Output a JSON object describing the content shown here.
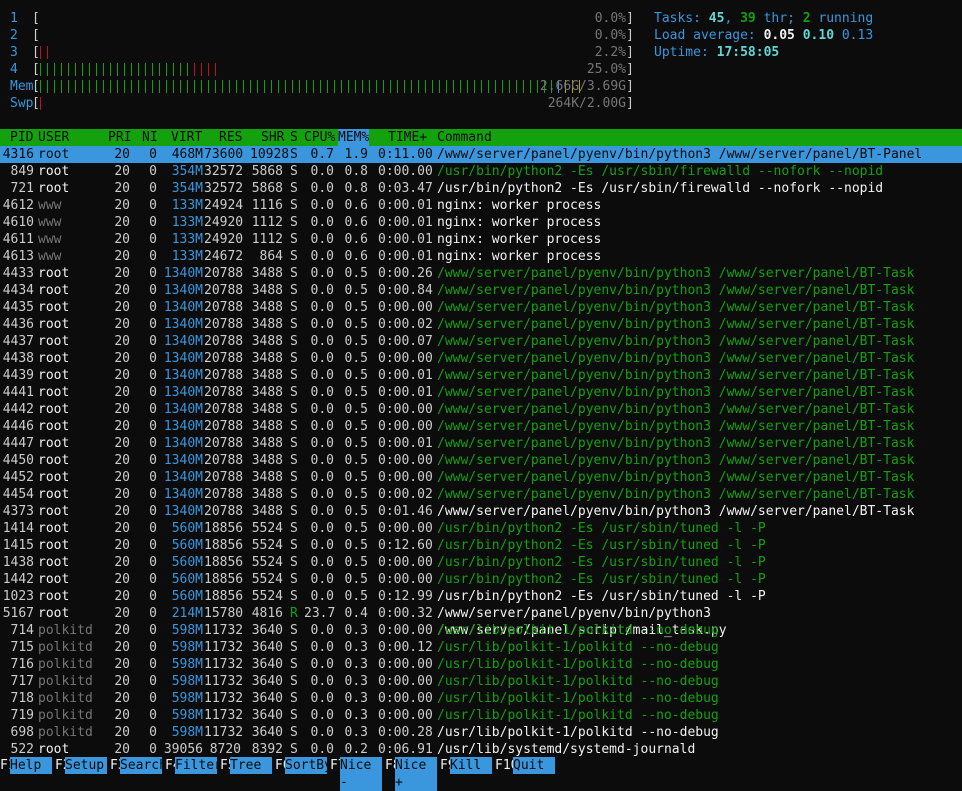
{
  "meters": [
    {
      "label": "1",
      "percent": "0.0%",
      "bars": []
    },
    {
      "label": "2",
      "percent": "0.0%",
      "bars": []
    },
    {
      "label": "3",
      "percent": "2.2%",
      "bars": [
        "r",
        "r"
      ]
    },
    {
      "label": "4",
      "percent": "25.0%",
      "bars": [
        "g",
        "g",
        "g",
        "g",
        "g",
        "g",
        "g",
        "g",
        "g",
        "g",
        "g",
        "g",
        "g",
        "g",
        "g",
        "g",
        "g",
        "g",
        "g",
        "g",
        "g",
        "g",
        "r",
        "r",
        "r",
        "r"
      ]
    },
    {
      "label": "Mem",
      "percent": "2.66G/3.69G",
      "bars": [
        "g",
        "g",
        "g",
        "g",
        "g",
        "g",
        "g",
        "g",
        "g",
        "g",
        "g",
        "g",
        "g",
        "g",
        "g",
        "g",
        "g",
        "g",
        "g",
        "g",
        "g",
        "g",
        "g",
        "g",
        "g",
        "g",
        "g",
        "g",
        "g",
        "g",
        "g",
        "g",
        "g",
        "g",
        "g",
        "g",
        "g",
        "g",
        "g",
        "g",
        "g",
        "g",
        "g",
        "g",
        "g",
        "g",
        "g",
        "g",
        "g",
        "g",
        "g",
        "g",
        "g",
        "g",
        "g",
        "g",
        "g",
        "g",
        "g",
        "g",
        "g",
        "g",
        "g",
        "g",
        "g",
        "g",
        "g",
        "g",
        "g",
        "g",
        "g",
        "g",
        "g",
        "g",
        "b",
        "y",
        "y",
        "y"
      ]
    },
    {
      "label": "Swp",
      "percent": "264K/2.00G",
      "bars": [
        "r"
      ]
    }
  ],
  "summary": {
    "tasks_label": "Tasks: ",
    "tasks": "45",
    "sep1": ", ",
    "threads": "39",
    "thr_label": " thr; ",
    "running": "2",
    "running_label": " running",
    "load_label": "Load average: ",
    "load1": "0.05",
    "load5": "0.10",
    "load15": "0.13",
    "uptime_label": "Uptime: ",
    "uptime": "17:58:05"
  },
  "columns": {
    "pid": "PID",
    "user": "USER",
    "pri": "PRI",
    "ni": "NI",
    "virt": "VIRT",
    "res": "RES",
    "shr": "SHR",
    "s": "S",
    "cpu": "CPU%",
    "mem": "MEM%",
    "time": "TIME+",
    "cmd": "Command"
  },
  "processes": [
    {
      "pid": "4316",
      "user": "root",
      "pri": "20",
      "ni": "0",
      "virt": "468M",
      "res": "73600",
      "shr": "10928",
      "s": "S",
      "cpu": "0.7",
      "mem": "1.9",
      "time": "0:11.00",
      "cmd": "/www/server/panel/pyenv/bin/python3 /www/server/panel/BT-Panel",
      "selected": true
    },
    {
      "pid": "849",
      "user": "root",
      "pri": "20",
      "ni": "0",
      "virt": "354M",
      "res": "32572",
      "shr": "5868",
      "s": "S",
      "cpu": "0.0",
      "mem": "0.8",
      "time": "0:00.00",
      "cmd": "/usr/bin/python2 -Es /usr/sbin/firewalld --nofork --nopid",
      "thread": true
    },
    {
      "pid": "721",
      "user": "root",
      "pri": "20",
      "ni": "0",
      "virt": "354M",
      "res": "32572",
      "shr": "5868",
      "s": "S",
      "cpu": "0.0",
      "mem": "0.8",
      "time": "0:03.47",
      "cmd": "/usr/bin/python2 -Es /usr/sbin/firewalld --nofork --nopid"
    },
    {
      "pid": "4612",
      "user": "www",
      "pri": "20",
      "ni": "0",
      "virt": "133M",
      "res": "24924",
      "shr": "1116",
      "s": "S",
      "cpu": "0.0",
      "mem": "0.6",
      "time": "0:00.01",
      "cmd": "nginx: worker process"
    },
    {
      "pid": "4610",
      "user": "www",
      "pri": "20",
      "ni": "0",
      "virt": "133M",
      "res": "24920",
      "shr": "1112",
      "s": "S",
      "cpu": "0.0",
      "mem": "0.6",
      "time": "0:00.01",
      "cmd": "nginx: worker process"
    },
    {
      "pid": "4611",
      "user": "www",
      "pri": "20",
      "ni": "0",
      "virt": "133M",
      "res": "24920",
      "shr": "1112",
      "s": "S",
      "cpu": "0.0",
      "mem": "0.6",
      "time": "0:00.01",
      "cmd": "nginx: worker process"
    },
    {
      "pid": "4613",
      "user": "www",
      "pri": "20",
      "ni": "0",
      "virt": "133M",
      "res": "24672",
      "shr": "864",
      "s": "S",
      "cpu": "0.0",
      "mem": "0.6",
      "time": "0:00.01",
      "cmd": "nginx: worker process"
    },
    {
      "pid": "4433",
      "user": "root",
      "pri": "20",
      "ni": "0",
      "virt": "1340M",
      "res": "20788",
      "shr": "3488",
      "s": "S",
      "cpu": "0.0",
      "mem": "0.5",
      "time": "0:00.26",
      "cmd": "/www/server/panel/pyenv/bin/python3 /www/server/panel/BT-Task",
      "thread": true
    },
    {
      "pid": "4434",
      "user": "root",
      "pri": "20",
      "ni": "0",
      "virt": "1340M",
      "res": "20788",
      "shr": "3488",
      "s": "S",
      "cpu": "0.0",
      "mem": "0.5",
      "time": "0:00.84",
      "cmd": "/www/server/panel/pyenv/bin/python3 /www/server/panel/BT-Task",
      "thread": true
    },
    {
      "pid": "4435",
      "user": "root",
      "pri": "20",
      "ni": "0",
      "virt": "1340M",
      "res": "20788",
      "shr": "3488",
      "s": "S",
      "cpu": "0.0",
      "mem": "0.5",
      "time": "0:00.00",
      "cmd": "/www/server/panel/pyenv/bin/python3 /www/server/panel/BT-Task",
      "thread": true
    },
    {
      "pid": "4436",
      "user": "root",
      "pri": "20",
      "ni": "0",
      "virt": "1340M",
      "res": "20788",
      "shr": "3488",
      "s": "S",
      "cpu": "0.0",
      "mem": "0.5",
      "time": "0:00.02",
      "cmd": "/www/server/panel/pyenv/bin/python3 /www/server/panel/BT-Task",
      "thread": true
    },
    {
      "pid": "4437",
      "user": "root",
      "pri": "20",
      "ni": "0",
      "virt": "1340M",
      "res": "20788",
      "shr": "3488",
      "s": "S",
      "cpu": "0.0",
      "mem": "0.5",
      "time": "0:00.07",
      "cmd": "/www/server/panel/pyenv/bin/python3 /www/server/panel/BT-Task",
      "thread": true
    },
    {
      "pid": "4438",
      "user": "root",
      "pri": "20",
      "ni": "0",
      "virt": "1340M",
      "res": "20788",
      "shr": "3488",
      "s": "S",
      "cpu": "0.0",
      "mem": "0.5",
      "time": "0:00.00",
      "cmd": "/www/server/panel/pyenv/bin/python3 /www/server/panel/BT-Task",
      "thread": true
    },
    {
      "pid": "4439",
      "user": "root",
      "pri": "20",
      "ni": "0",
      "virt": "1340M",
      "res": "20788",
      "shr": "3488",
      "s": "S",
      "cpu": "0.0",
      "mem": "0.5",
      "time": "0:00.01",
      "cmd": "/www/server/panel/pyenv/bin/python3 /www/server/panel/BT-Task",
      "thread": true
    },
    {
      "pid": "4441",
      "user": "root",
      "pri": "20",
      "ni": "0",
      "virt": "1340M",
      "res": "20788",
      "shr": "3488",
      "s": "S",
      "cpu": "0.0",
      "mem": "0.5",
      "time": "0:00.01",
      "cmd": "/www/server/panel/pyenv/bin/python3 /www/server/panel/BT-Task",
      "thread": true
    },
    {
      "pid": "4442",
      "user": "root",
      "pri": "20",
      "ni": "0",
      "virt": "1340M",
      "res": "20788",
      "shr": "3488",
      "s": "S",
      "cpu": "0.0",
      "mem": "0.5",
      "time": "0:00.00",
      "cmd": "/www/server/panel/pyenv/bin/python3 /www/server/panel/BT-Task",
      "thread": true
    },
    {
      "pid": "4446",
      "user": "root",
      "pri": "20",
      "ni": "0",
      "virt": "1340M",
      "res": "20788",
      "shr": "3488",
      "s": "S",
      "cpu": "0.0",
      "mem": "0.5",
      "time": "0:00.00",
      "cmd": "/www/server/panel/pyenv/bin/python3 /www/server/panel/BT-Task",
      "thread": true
    },
    {
      "pid": "4447",
      "user": "root",
      "pri": "20",
      "ni": "0",
      "virt": "1340M",
      "res": "20788",
      "shr": "3488",
      "s": "S",
      "cpu": "0.0",
      "mem": "0.5",
      "time": "0:00.01",
      "cmd": "/www/server/panel/pyenv/bin/python3 /www/server/panel/BT-Task",
      "thread": true
    },
    {
      "pid": "4450",
      "user": "root",
      "pri": "20",
      "ni": "0",
      "virt": "1340M",
      "res": "20788",
      "shr": "3488",
      "s": "S",
      "cpu": "0.0",
      "mem": "0.5",
      "time": "0:00.00",
      "cmd": "/www/server/panel/pyenv/bin/python3 /www/server/panel/BT-Task",
      "thread": true
    },
    {
      "pid": "4452",
      "user": "root",
      "pri": "20",
      "ni": "0",
      "virt": "1340M",
      "res": "20788",
      "shr": "3488",
      "s": "S",
      "cpu": "0.0",
      "mem": "0.5",
      "time": "0:00.00",
      "cmd": "/www/server/panel/pyenv/bin/python3 /www/server/panel/BT-Task",
      "thread": true
    },
    {
      "pid": "4454",
      "user": "root",
      "pri": "20",
      "ni": "0",
      "virt": "1340M",
      "res": "20788",
      "shr": "3488",
      "s": "S",
      "cpu": "0.0",
      "mem": "0.5",
      "time": "0:00.02",
      "cmd": "/www/server/panel/pyenv/bin/python3 /www/server/panel/BT-Task",
      "thread": true
    },
    {
      "pid": "4373",
      "user": "root",
      "pri": "20",
      "ni": "0",
      "virt": "1340M",
      "res": "20788",
      "shr": "3488",
      "s": "S",
      "cpu": "0.0",
      "mem": "0.5",
      "time": "0:01.46",
      "cmd": "/www/server/panel/pyenv/bin/python3 /www/server/panel/BT-Task"
    },
    {
      "pid": "1414",
      "user": "root",
      "pri": "20",
      "ni": "0",
      "virt": "560M",
      "res": "18856",
      "shr": "5524",
      "s": "S",
      "cpu": "0.0",
      "mem": "0.5",
      "time": "0:00.00",
      "cmd": "/usr/bin/python2 -Es /usr/sbin/tuned -l -P",
      "thread": true
    },
    {
      "pid": "1415",
      "user": "root",
      "pri": "20",
      "ni": "0",
      "virt": "560M",
      "res": "18856",
      "shr": "5524",
      "s": "S",
      "cpu": "0.0",
      "mem": "0.5",
      "time": "0:12.60",
      "cmd": "/usr/bin/python2 -Es /usr/sbin/tuned -l -P",
      "thread": true
    },
    {
      "pid": "1438",
      "user": "root",
      "pri": "20",
      "ni": "0",
      "virt": "560M",
      "res": "18856",
      "shr": "5524",
      "s": "S",
      "cpu": "0.0",
      "mem": "0.5",
      "time": "0:00.00",
      "cmd": "/usr/bin/python2 -Es /usr/sbin/tuned -l -P",
      "thread": true
    },
    {
      "pid": "1442",
      "user": "root",
      "pri": "20",
      "ni": "0",
      "virt": "560M",
      "res": "18856",
      "shr": "5524",
      "s": "S",
      "cpu": "0.0",
      "mem": "0.5",
      "time": "0:00.00",
      "cmd": "/usr/bin/python2 -Es /usr/sbin/tuned -l -P",
      "thread": true
    },
    {
      "pid": "1023",
      "user": "root",
      "pri": "20",
      "ni": "0",
      "virt": "560M",
      "res": "18856",
      "shr": "5524",
      "s": "S",
      "cpu": "0.0",
      "mem": "0.5",
      "time": "0:12.99",
      "cmd": "/usr/bin/python2 -Es /usr/sbin/tuned -l -P"
    },
    {
      "pid": "5167",
      "user": "root",
      "pri": "20",
      "ni": "0",
      "virt": "214M",
      "res": "15780",
      "shr": "4816",
      "s": "R",
      "cpu": "23.7",
      "mem": "0.4",
      "time": "0:00.32",
      "cmd": "/www/server/panel/pyenv/bin/python3 /www/server/panel/script/mail_task.py"
    },
    {
      "pid": "714",
      "user": "polkitd",
      "pri": "20",
      "ni": "0",
      "virt": "598M",
      "res": "11732",
      "shr": "3640",
      "s": "S",
      "cpu": "0.0",
      "mem": "0.3",
      "time": "0:00.00",
      "cmd": "/usr/lib/polkit-1/polkitd --no-debug",
      "thread": true
    },
    {
      "pid": "715",
      "user": "polkitd",
      "pri": "20",
      "ni": "0",
      "virt": "598M",
      "res": "11732",
      "shr": "3640",
      "s": "S",
      "cpu": "0.0",
      "mem": "0.3",
      "time": "0:00.12",
      "cmd": "/usr/lib/polkit-1/polkitd --no-debug",
      "thread": true
    },
    {
      "pid": "716",
      "user": "polkitd",
      "pri": "20",
      "ni": "0",
      "virt": "598M",
      "res": "11732",
      "shr": "3640",
      "s": "S",
      "cpu": "0.0",
      "mem": "0.3",
      "time": "0:00.00",
      "cmd": "/usr/lib/polkit-1/polkitd --no-debug",
      "thread": true
    },
    {
      "pid": "717",
      "user": "polkitd",
      "pri": "20",
      "ni": "0",
      "virt": "598M",
      "res": "11732",
      "shr": "3640",
      "s": "S",
      "cpu": "0.0",
      "mem": "0.3",
      "time": "0:00.00",
      "cmd": "/usr/lib/polkit-1/polkitd --no-debug",
      "thread": true
    },
    {
      "pid": "718",
      "user": "polkitd",
      "pri": "20",
      "ni": "0",
      "virt": "598M",
      "res": "11732",
      "shr": "3640",
      "s": "S",
      "cpu": "0.0",
      "mem": "0.3",
      "time": "0:00.00",
      "cmd": "/usr/lib/polkit-1/polkitd --no-debug",
      "thread": true
    },
    {
      "pid": "719",
      "user": "polkitd",
      "pri": "20",
      "ni": "0",
      "virt": "598M",
      "res": "11732",
      "shr": "3640",
      "s": "S",
      "cpu": "0.0",
      "mem": "0.3",
      "time": "0:00.00",
      "cmd": "/usr/lib/polkit-1/polkitd --no-debug",
      "thread": true
    },
    {
      "pid": "698",
      "user": "polkitd",
      "pri": "20",
      "ni": "0",
      "virt": "598M",
      "res": "11732",
      "shr": "3640",
      "s": "S",
      "cpu": "0.0",
      "mem": "0.3",
      "time": "0:00.28",
      "cmd": "/usr/lib/polkit-1/polkitd --no-debug"
    },
    {
      "pid": "522",
      "user": "root",
      "pri": "20",
      "ni": "0",
      "virt": "39056",
      "res": "8720",
      "shr": "8392",
      "s": "S",
      "cpu": "0.0",
      "mem": "0.2",
      "time": "0:06.91",
      "cmd": "/usr/lib/systemd/systemd-journald"
    }
  ],
  "footer": [
    {
      "key": "F1",
      "label": "Help  "
    },
    {
      "key": "F2",
      "label": "Setup "
    },
    {
      "key": "F3",
      "label": "Search"
    },
    {
      "key": "F4",
      "label": "Filter"
    },
    {
      "key": "F5",
      "label": "Tree  "
    },
    {
      "key": "F6",
      "label": "SortBy"
    },
    {
      "key": "F7",
      "label": "Nice -"
    },
    {
      "key": "F8",
      "label": "Nice +"
    },
    {
      "key": "F9",
      "label": "Kill  "
    },
    {
      "key": "F10",
      "label": "Quit  "
    }
  ],
  "colors": {
    "background": "#0c0c0c",
    "header_bg": "#13a10e",
    "selected_bg": "#3a96dd",
    "label": "#3a96dd",
    "thread_cmd": "#13a10e"
  }
}
